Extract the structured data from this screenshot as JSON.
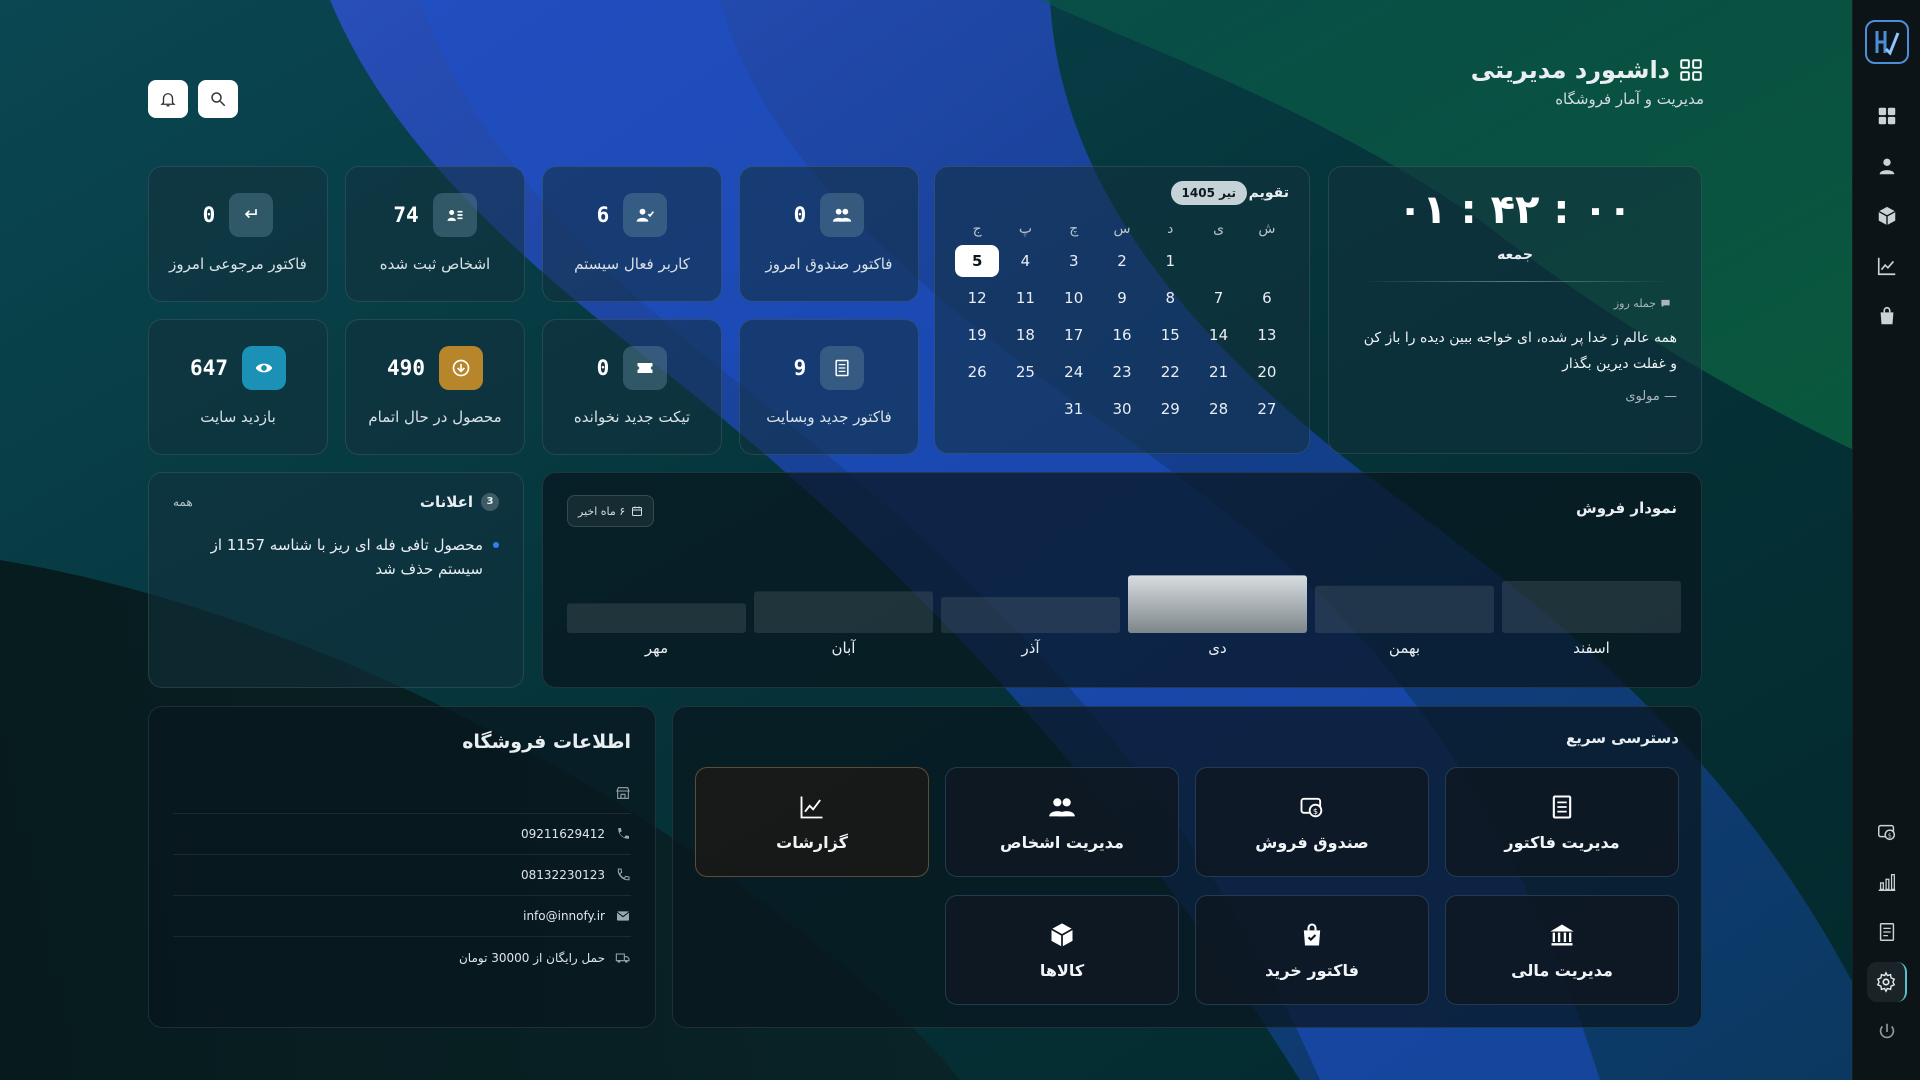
{
  "header": {
    "title": "داشبورد مدیریتی",
    "subtitle": "مدیریت و آمار فروشگاه"
  },
  "stats": [
    {
      "key": "return_invoices",
      "label": "فاکتور مرجوعی امروز",
      "value": "0",
      "icon": "return-icon"
    },
    {
      "key": "people",
      "label": "اشخاص ثبت شده",
      "value": "74",
      "icon": "contact-card-icon"
    },
    {
      "key": "active_users",
      "label": "کاربر فعال سیستم",
      "value": "6",
      "icon": "user-check-icon"
    },
    {
      "key": "cashbox_invoices",
      "label": "فاکتور صندوق امروز",
      "value": "0",
      "icon": "users-icon"
    },
    {
      "key": "site_visits",
      "label": "بازدید سایت",
      "value": "647",
      "icon": "eye-icon",
      "accent": "#1a91b5"
    },
    {
      "key": "low_stock",
      "label": "محصول در حال اتمام",
      "value": "490",
      "icon": "download-circle-icon",
      "accent": "#b8862a"
    },
    {
      "key": "unread_tickets",
      "label": "تیکت جدید نخوانده",
      "value": "0",
      "icon": "ticket-icon"
    },
    {
      "key": "web_invoices",
      "label": "فاکتور جدید وبسایت",
      "value": "9",
      "icon": "receipt-icon"
    }
  ],
  "clock": {
    "time": "۰۱ : ۴۲ : ۰۰",
    "day": "جمعه",
    "quote_label": "جمله روز",
    "quote": "همه عالم ز خدا پر شده، ای خواجه ببین دیده را باز کن و غفلت دیرین بگذار",
    "author": "— مولوی"
  },
  "calendar": {
    "title": "تقویم",
    "month": "تیر 1405",
    "weekdays": [
      "ش",
      "ی",
      "د",
      "س",
      "چ",
      "پ",
      "ج"
    ],
    "today": "5",
    "weeks": [
      [
        "",
        "",
        "1",
        "2",
        "3",
        "4",
        "5"
      ],
      [
        "6",
        "7",
        "8",
        "9",
        "10",
        "11",
        "12"
      ],
      [
        "13",
        "14",
        "15",
        "16",
        "17",
        "18",
        "19"
      ],
      [
        "20",
        "21",
        "22",
        "23",
        "24",
        "25",
        "26"
      ],
      [
        "27",
        "28",
        "29",
        "30",
        "31",
        "",
        ""
      ]
    ]
  },
  "notifications": {
    "title": "اعلانات",
    "count": "3",
    "all_label": "همه",
    "items": [
      "محصول تافی فله ای ریز با شناسه 1157 از سیستم حذف شد"
    ]
  },
  "sales_chart": {
    "title": "نمودار فروش",
    "filter": "۶ ماه اخیر",
    "highlight_color": "#d8dde0"
  },
  "chart_data": {
    "type": "bar",
    "title": "نمودار فروش",
    "categories": [
      "مهر",
      "آبان",
      "آذر",
      "دی",
      "بهمن",
      "اسفند"
    ],
    "values": [
      37,
      52,
      45,
      72,
      59,
      65
    ],
    "highlight_index": 3,
    "ylim": [
      0,
      100
    ],
    "grid": false
  },
  "store": {
    "title": "اطلاعات فروشگاه",
    "rows": [
      {
        "icon": "store-icon",
        "text": ""
      },
      {
        "icon": "phone-icon",
        "text": "09211629412"
      },
      {
        "icon": "phone-outline-icon",
        "text": "08132230123"
      },
      {
        "icon": "mail-icon",
        "text": "info@innofy.ir"
      },
      {
        "icon": "truck-icon",
        "text": "حمل رایگان از 30000 تومان"
      }
    ]
  },
  "quick_access": {
    "title": "دسترسی سریع",
    "tiles": [
      {
        "label": "مدیریت فاکتور",
        "icon": "receipt-icon"
      },
      {
        "label": "صندوق فروش",
        "icon": "cash-register-icon"
      },
      {
        "label": "مدیریت اشخاص",
        "icon": "users-icon"
      },
      {
        "label": "گزارشات",
        "icon": "chart-line-icon"
      },
      {
        "label": "مدیریت مالی",
        "icon": "bank-icon"
      },
      {
        "label": "فاکتور خرید",
        "icon": "shopping-bag-icon"
      },
      {
        "label": "کالاها",
        "icon": "box-icon"
      }
    ]
  }
}
